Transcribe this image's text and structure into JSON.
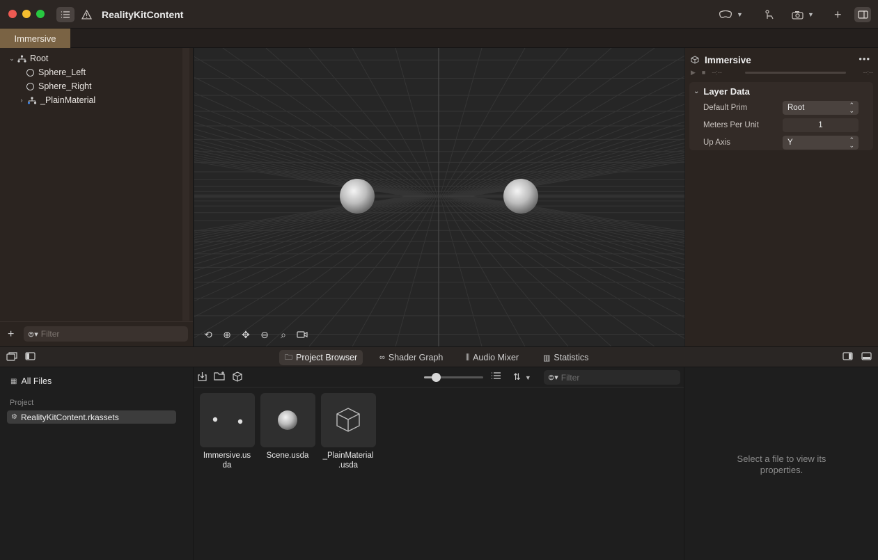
{
  "window": {
    "title": "RealityKitContent",
    "document_tab": "Immersive"
  },
  "toolbar_icons": [
    "sidebar-toggle-icon",
    "warning-icon",
    "headset-icon",
    "gesture-icon",
    "camera-icon",
    "plus-icon",
    "inspector-toggle-icon"
  ],
  "hierarchy": {
    "items": [
      {
        "label": "Root",
        "icon": "entity-icon",
        "expanded": true
      },
      {
        "label": "Sphere_Left",
        "icon": "circle-icon"
      },
      {
        "label": "Sphere_Right",
        "icon": "circle-icon"
      },
      {
        "label": "_PlainMaterial",
        "icon": "material-icon",
        "expanded": false
      }
    ],
    "filter_placeholder": "Filter"
  },
  "viewport": {
    "tools": [
      "orbit-icon",
      "pan-icon",
      "move-icon",
      "rotate-icon",
      "zoom-icon",
      "camera-view-icon"
    ]
  },
  "inspector": {
    "title": "Immersive",
    "playback_start": "--:--",
    "playback_end": "--:--",
    "section": {
      "title": "Layer Data",
      "fields": {
        "default_prim_label": "Default Prim",
        "default_prim_value": "Root",
        "meters_per_unit_label": "Meters Per Unit",
        "meters_per_unit_value": "1",
        "up_axis_label": "Up Axis",
        "up_axis_value": "Y"
      }
    }
  },
  "bottom_tabs": [
    {
      "label": "Project Browser",
      "icon": "folder-icon",
      "active": true
    },
    {
      "label": "Shader Graph",
      "icon": "shader-graph-icon",
      "active": false
    },
    {
      "label": "Audio Mixer",
      "icon": "audio-mixer-icon",
      "active": false
    },
    {
      "label": "Statistics",
      "icon": "statistics-icon",
      "active": false
    }
  ],
  "project_browser": {
    "all_files": "All Files",
    "project_heading": "Project",
    "project_item": "RealityKitContent.rkassets",
    "filter_placeholder": "Filter",
    "files": [
      {
        "line1": "Immersive.us",
        "line2": "da"
      },
      {
        "line1": "Scene.usda",
        "line2": ""
      },
      {
        "line1": "_PlainMaterial",
        "line2": ".usda"
      }
    ],
    "empty_message": "Select a file to view its properties."
  }
}
